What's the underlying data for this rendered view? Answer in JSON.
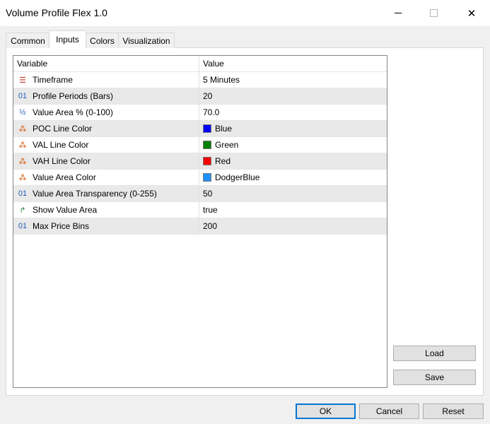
{
  "window": {
    "title": "Volume Profile Flex 1.0",
    "min_icon": "minimize-icon",
    "max_icon": "maximize-icon",
    "close_icon": "close-icon",
    "close_glyph": "✕"
  },
  "tabs": [
    {
      "label": "Common",
      "active": false
    },
    {
      "label": "Inputs",
      "active": true
    },
    {
      "label": "Colors",
      "active": false
    },
    {
      "label": "Visualization",
      "active": false
    }
  ],
  "grid": {
    "headers": {
      "variable": "Variable",
      "value": "Value"
    },
    "rows": [
      {
        "icon": "timeframe-icon",
        "glyph": "☰",
        "variable": "Timeframe",
        "value": "5 Minutes"
      },
      {
        "icon": "integer-icon",
        "glyph": "01",
        "variable": "Profile Periods (Bars)",
        "value": "20"
      },
      {
        "icon": "fraction-icon",
        "glyph": "½",
        "variable": "Value Area % (0-100)",
        "value": "70.0"
      },
      {
        "icon": "color-icon",
        "glyph": "⁂",
        "variable": "POC Line Color",
        "value": "Blue",
        "swatch": "#0000ff"
      },
      {
        "icon": "color-icon",
        "glyph": "⁂",
        "variable": "VAL Line Color",
        "value": "Green",
        "swatch": "#008000"
      },
      {
        "icon": "color-icon",
        "glyph": "⁂",
        "variable": "VAH Line Color",
        "value": "Red",
        "swatch": "#ff0000"
      },
      {
        "icon": "color-icon",
        "glyph": "⁂",
        "variable": "Value Area Color",
        "value": "DodgerBlue",
        "swatch": "#1e90ff"
      },
      {
        "icon": "integer-icon",
        "glyph": "01",
        "variable": "Value Area Transparency (0-255)",
        "value": "50"
      },
      {
        "icon": "boolean-icon",
        "glyph": "↱",
        "variable": "Show Value Area",
        "value": "true"
      },
      {
        "icon": "integer-icon",
        "glyph": "01",
        "variable": "Max Price Bins",
        "value": "200"
      }
    ]
  },
  "buttons": {
    "load": "Load",
    "save": "Save",
    "ok": "OK",
    "cancel": "Cancel",
    "reset": "Reset"
  }
}
